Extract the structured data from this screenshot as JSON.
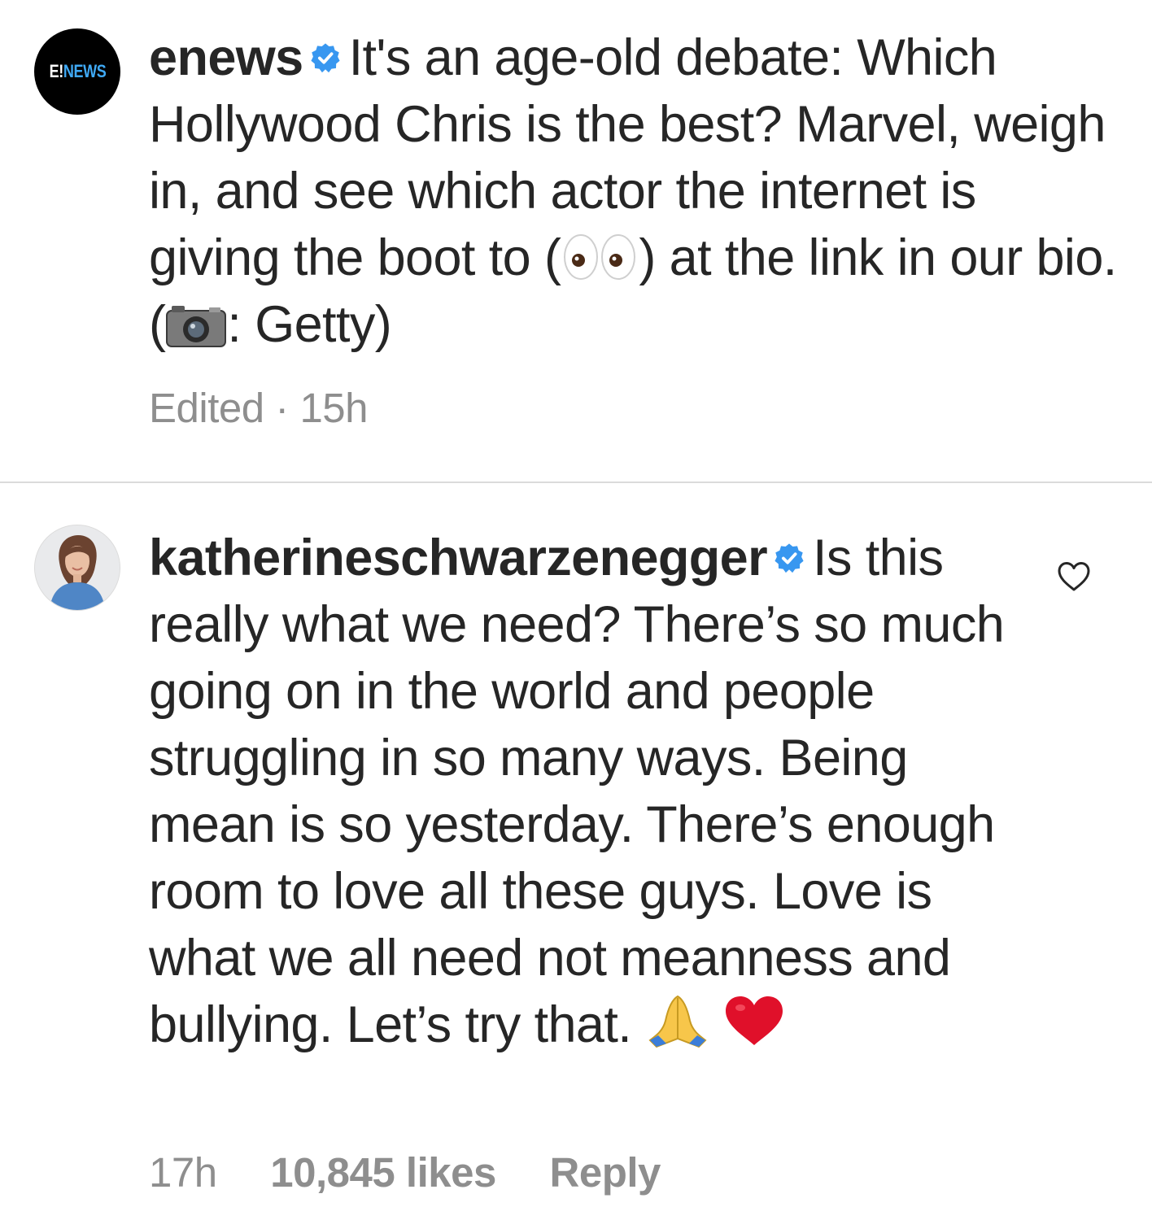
{
  "caption": {
    "avatar_logo": {
      "e": "E!",
      "news": "NEWS"
    },
    "avatar_icon": "e-news-logo",
    "username": "enews",
    "verified_icon": "verified-badge-icon",
    "text_part1": "It's an age-old debate: Which Hollywood Chris is the best? Marvel, weigh in, and see which actor the internet is giving the boot to (",
    "emoji_eyes": "eyes-emoji",
    "text_part2": ") at the link in our bio. (",
    "emoji_camera": "camera-emoji",
    "text_part3": ": Getty)",
    "edited_label": "Edited",
    "separator": "·",
    "time": "15h"
  },
  "comment": {
    "avatar_icon": "profile-photo",
    "username": "katherineschwarzenegger",
    "verified_icon": "verified-badge-icon",
    "text": "Is this really what we need? There’s so much going on in the world and people struggling in so many ways. Being mean is so yesterday. There’s enough room to love all these guys. Love is what we all need not meanness and bullying. Let’s try that.",
    "emoji_pray": "folded-hands-emoji",
    "emoji_heart": "red-heart-emoji",
    "time": "17h",
    "likes": "10,845 likes",
    "reply_label": "Reply",
    "like_icon": "heart-outline-icon"
  },
  "colors": {
    "text": "#262626",
    "meta": "#8e8e8e",
    "verified": "#3897f0",
    "divider": "#dbdbdb",
    "news_blue": "#3fa9f5",
    "heart_red": "#e0102a"
  }
}
